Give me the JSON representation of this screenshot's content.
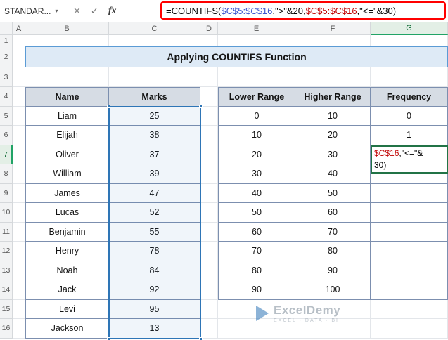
{
  "formula_bar": {
    "name_box": "STANDAR...",
    "name_box_arrow": "▾",
    "cancel_icon": "✕",
    "confirm_icon": "✓",
    "fx_label": "fx",
    "formula_parts": {
      "p1": "=COUNTIFS(",
      "p2": "$C$5:$C$16",
      "p3": ",\">\"&20,",
      "p4": "$C$5:$C$16",
      "p5": ",\"<=\"&30)"
    }
  },
  "sheet": {
    "title": "Applying COUNTIFS Function",
    "columns": [
      "A",
      "B",
      "C",
      "D",
      "E",
      "F",
      "G"
    ],
    "row_count": 16,
    "name_table": {
      "headers": [
        "Name",
        "Marks"
      ],
      "rows": [
        [
          "Liam",
          "25"
        ],
        [
          "Elijah",
          "38"
        ],
        [
          "Oliver",
          "37"
        ],
        [
          "William",
          "39"
        ],
        [
          "James",
          "47"
        ],
        [
          "Lucas",
          "52"
        ],
        [
          "Benjamin",
          "55"
        ],
        [
          "Henry",
          "78"
        ],
        [
          "Noah",
          "84"
        ],
        [
          "Jack",
          "92"
        ],
        [
          "Levi",
          "95"
        ],
        [
          "Jackson",
          "13"
        ]
      ]
    },
    "range_table": {
      "headers": [
        "Lower Range",
        "Higher Range",
        "Frequency"
      ],
      "rows": [
        [
          "0",
          "10",
          "0"
        ],
        [
          "10",
          "20",
          "1"
        ],
        [
          "20",
          "30",
          ""
        ],
        [
          "30",
          "40",
          ""
        ],
        [
          "40",
          "50",
          ""
        ],
        [
          "50",
          "60",
          ""
        ],
        [
          "60",
          "70",
          ""
        ],
        [
          "70",
          "80",
          ""
        ],
        [
          "80",
          "90",
          ""
        ],
        [
          "90",
          "100",
          ""
        ]
      ]
    },
    "editing_cell": {
      "cell": "G7",
      "line1_range": "$C$16",
      "line1_rest": ",\"<=\"&",
      "line2": "30)"
    },
    "selected_range": "C5:C16"
  },
  "watermark": {
    "brand": "ExcelDemy",
    "tagline": "EXCEL · DATA · BI"
  },
  "colors": {
    "annotation_red": "#FF0000",
    "ref_blue": "#3B55CE",
    "ref_red": "#C00000",
    "selection_blue": "#2E75B6",
    "edit_green": "#217346",
    "title_bg": "#DEEAF6",
    "title_border": "#5B9BD5",
    "table_header_bg": "#D6DCE4",
    "table_border": "#7C8FAF",
    "active_header_green": "#21A366"
  }
}
